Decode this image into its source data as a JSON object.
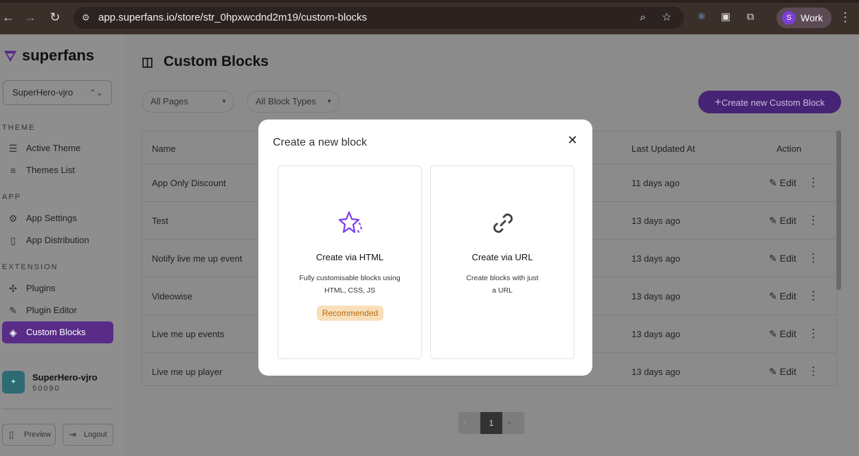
{
  "browser": {
    "url": "app.superfans.io/store/str_0hpxwcdnd2m19/custom-blocks",
    "profile_initial": "S",
    "profile_name": "Work"
  },
  "sidebar": {
    "brand": "superfans",
    "store_select": "SuperHero-vjro",
    "sections": {
      "theme": "THEME",
      "app": "APP",
      "extension": "EXTENSION"
    },
    "items": [
      {
        "label": "Active Theme",
        "icon": "palette-icon"
      },
      {
        "label": "Themes List",
        "icon": "list-icon"
      },
      {
        "label": "App Settings",
        "icon": "gear-icon"
      },
      {
        "label": "App Distribution",
        "icon": "phone-icon"
      },
      {
        "label": "Plugins",
        "icon": "puzzle-icon"
      },
      {
        "label": "Plugin Editor",
        "icon": "wand-icon"
      },
      {
        "label": "Custom Blocks",
        "icon": "blocks-icon"
      }
    ],
    "store_card": {
      "name": "SuperHero-vjro",
      "id": "50090"
    },
    "preview_label": "Preview",
    "logout_label": "Logout"
  },
  "main": {
    "title": "Custom Blocks",
    "filters": {
      "pages": "All Pages",
      "block_types": "All Block Types"
    },
    "create_button": "Create new Custom Block",
    "table": {
      "headers": {
        "name": "Name",
        "updated": "Last Updated At",
        "action": "Action"
      },
      "edit_label": "Edit",
      "rows": [
        {
          "name": "App Only Discount",
          "updated": "11 days ago"
        },
        {
          "name": "Test",
          "updated": "13 days ago"
        },
        {
          "name": "Notify live me up event",
          "updated": "13 days ago"
        },
        {
          "name": "Videowise",
          "updated": "13 days ago"
        },
        {
          "name": "Live me up events",
          "updated": "13 days ago"
        },
        {
          "name": "Live me up player",
          "updated": "13 days ago"
        }
      ]
    },
    "pagination": {
      "current": "1"
    }
  },
  "modal": {
    "title": "Create a new block",
    "options": [
      {
        "title": "Create via HTML",
        "desc_line1": "Fully customisable blocks using",
        "desc_line2": "HTML, CSS, JS",
        "badge": "Recommended",
        "icon": "sparkle-star-icon"
      },
      {
        "title": "Create via URL",
        "desc_line1": "Create blocks with just",
        "desc_line2": "a URL",
        "icon": "link-icon"
      }
    ]
  },
  "colors": {
    "accent": "#7c3aed",
    "badge_bg": "#f8dfba",
    "badge_text": "#b8690f"
  }
}
